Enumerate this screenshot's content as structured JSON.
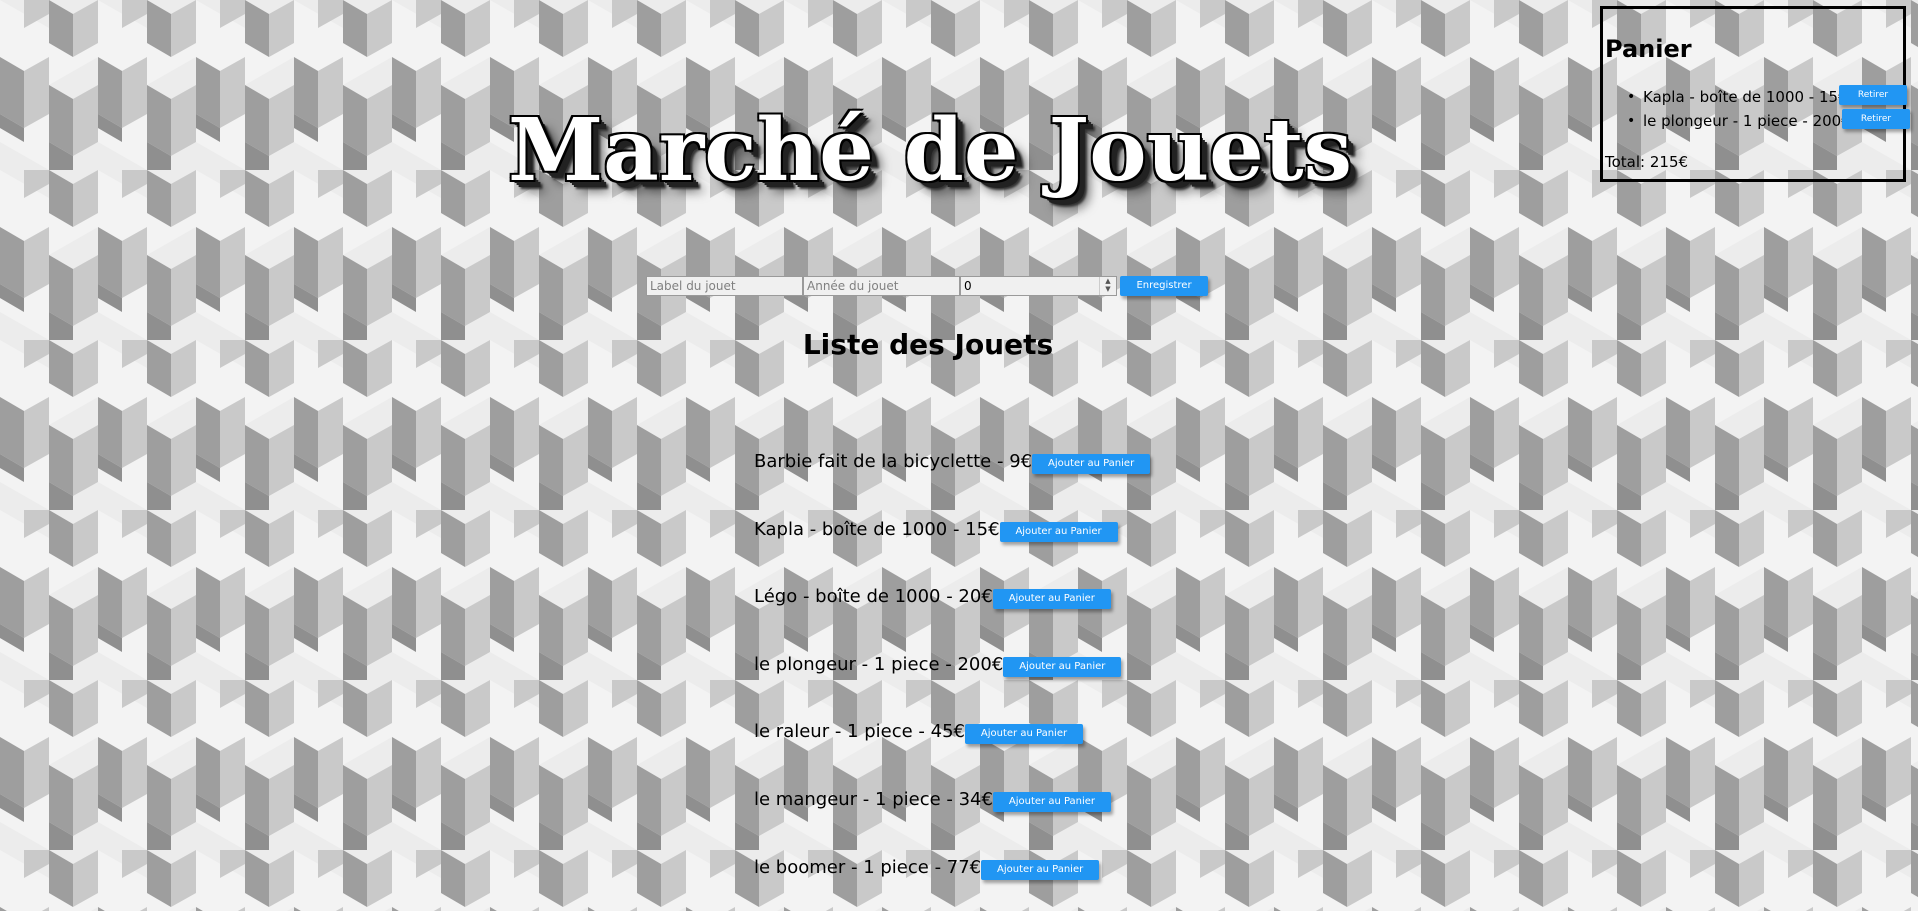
{
  "title": "Marché de Jouets",
  "cart": {
    "heading": "Panier",
    "items": [
      {
        "text": "Kapla - boîte de 1000 - 15€",
        "button": "Retirer"
      },
      {
        "text": "le plongeur - 1 piece - 200€",
        "button": "Retirer"
      }
    ],
    "total": "Total: 215€"
  },
  "form": {
    "label_placeholder": "Label du jouet",
    "year_placeholder": "Année du jouet",
    "price_value": "0",
    "save_label": "Enregistrer"
  },
  "list": {
    "heading": "Liste des Jouets",
    "add_label": "Ajouter au Panier",
    "items": [
      {
        "text": "Barbie fait de la bicyclette - 9€"
      },
      {
        "text": "Kapla - boîte de 1000 - 15€"
      },
      {
        "text": "Légo - boîte de 1000 - 20€"
      },
      {
        "text": "le plongeur - 1 piece - 200€"
      },
      {
        "text": "le raleur - 1 piece - 45€"
      },
      {
        "text": "le mangeur - 1 piece - 34€"
      },
      {
        "text": "le boomer - 1 piece - 77€"
      }
    ]
  },
  "colors": {
    "button_bg": "#2196f3",
    "button_text": "#ffffff"
  }
}
